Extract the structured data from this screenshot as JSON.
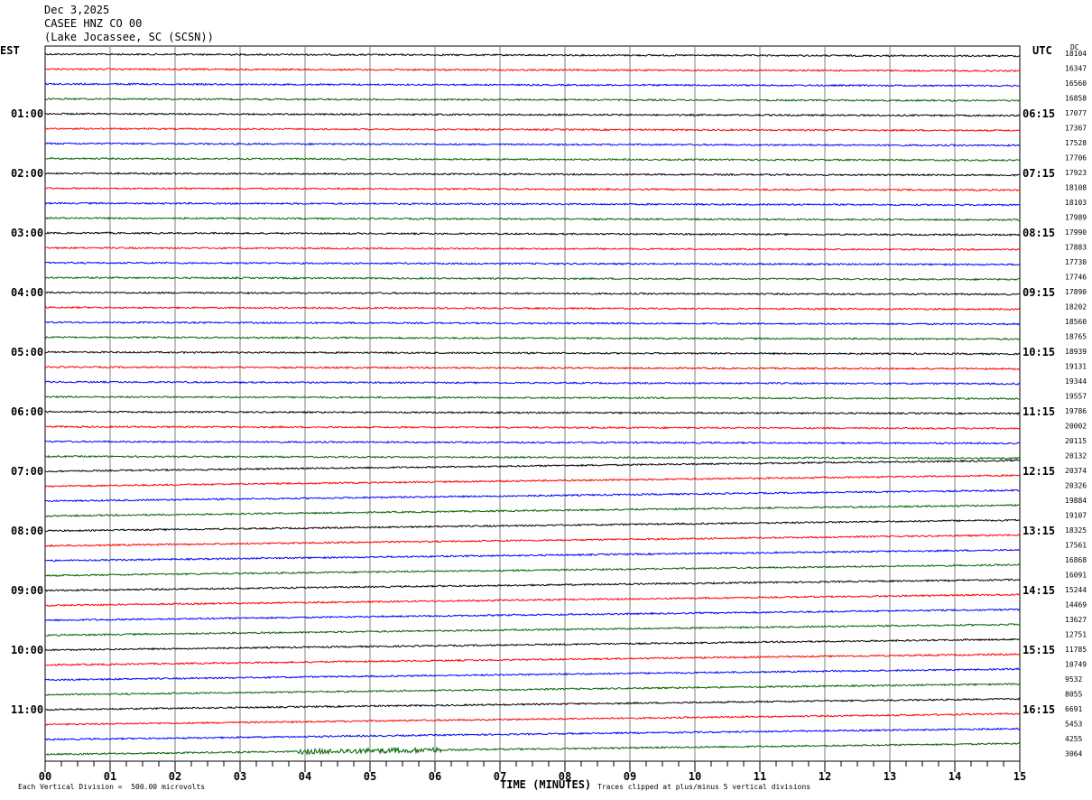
{
  "header": {
    "date": "Dec 3,2025",
    "station": "CASEE HNZ CO 00",
    "location": "(Lake Jocassee, SC (SCSN))"
  },
  "labels": {
    "left_tz": "EST",
    "right_tz": "UTC",
    "dc": "DC",
    "xlabel": "TIME (MINUTES)",
    "scale_note": "Each Vertical Division =  500.00 microvolts",
    "clip_note": "Traces clipped at plus/minus 5 vertical divisions"
  },
  "chart_data": {
    "type": "line",
    "title": "CASEE HNZ CO 00",
    "xlabel": "TIME (MINUTES)",
    "ylabel": "",
    "xlim": [
      0,
      15
    ],
    "x_ticks": [
      "00",
      "01",
      "02",
      "03",
      "04",
      "05",
      "06",
      "07",
      "08",
      "09",
      "10",
      "11",
      "12",
      "13",
      "14",
      "15"
    ],
    "grid": "vertical lines every minute",
    "trace_colors": [
      "#000000",
      "#ff0000",
      "#0000ff",
      "#006400"
    ],
    "left_time_labels": [
      "01:00",
      "02:00",
      "03:00",
      "04:00",
      "05:00",
      "06:00",
      "07:00",
      "08:00",
      "09:00",
      "10:00",
      "11:00"
    ],
    "right_time_labels": [
      "06:15",
      "07:15",
      "08:15",
      "09:15",
      "10:15",
      "11:15",
      "12:15",
      "13:15",
      "14:15",
      "15:15",
      "16:15"
    ],
    "dc_offsets": [
      18104,
      16347,
      16560,
      16858,
      17077,
      17367,
      17528,
      17706,
      17923,
      18108,
      18103,
      17989,
      17990,
      17883,
      17730,
      17746,
      17890,
      18202,
      18560,
      18765,
      18939,
      19131,
      19344,
      19557,
      19786,
      20002,
      20115,
      20132,
      20374,
      20326,
      19884,
      19107,
      18325,
      17561,
      16868,
      16091,
      15244,
      14469,
      13627,
      12751,
      11785,
      10749,
      9532,
      8055,
      6691,
      5453,
      4255,
      3064
    ]
  }
}
